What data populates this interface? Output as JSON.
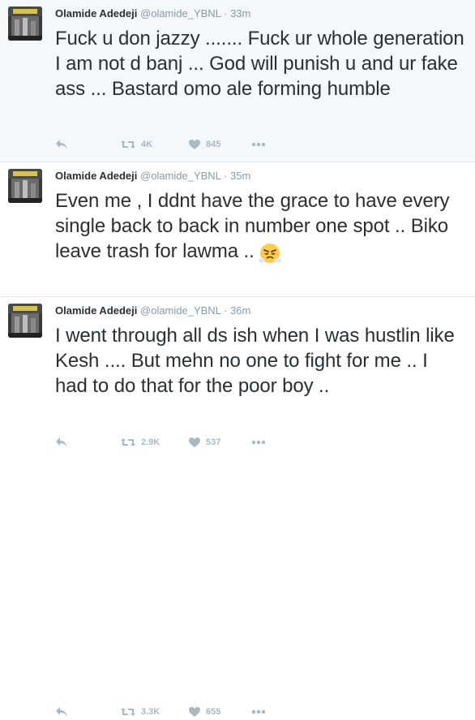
{
  "tweets": [
    {
      "name": "Olamide Adedeji",
      "handle": "@olamide_YBNL",
      "separator": "·",
      "time": "33m",
      "text": "Fuck u don jazzy ....... Fuck ur whole generation I am not d banj ... God will punish u and ur fake ass ... Bastard omo ale forming humble",
      "retweets": "4K",
      "likes": "845"
    },
    {
      "name": "Olamide Adedeji",
      "handle": "@olamide_YBNL",
      "separator": "·",
      "time": "35m",
      "text": "Even me , I ddnt have the grace to have every single back to back in number one spot .. Biko leave trash for lawma ..",
      "emoji": "steam-from-nose-face",
      "retweets": "2.9K",
      "likes": "537"
    },
    {
      "name": "Olamide Adedeji",
      "handle": "@olamide_YBNL",
      "separator": "·",
      "time": "36m",
      "text": "I went through all ds ish when I was hustlin like Kesh .... But mehn no one to fight for me .. I had to do that for the poor boy ..",
      "retweets": "3.3K",
      "likes": "655"
    }
  ],
  "icons": {
    "reply": "reply-icon",
    "retweet": "retweet-icon",
    "like": "heart-icon",
    "more": "more-dots-icon"
  },
  "colors": {
    "highlight_bg": "#f5f8fa",
    "name": "#292f33",
    "meta": "#8899a6",
    "action": "#aab8c2",
    "divider": "#e1e8ed"
  }
}
